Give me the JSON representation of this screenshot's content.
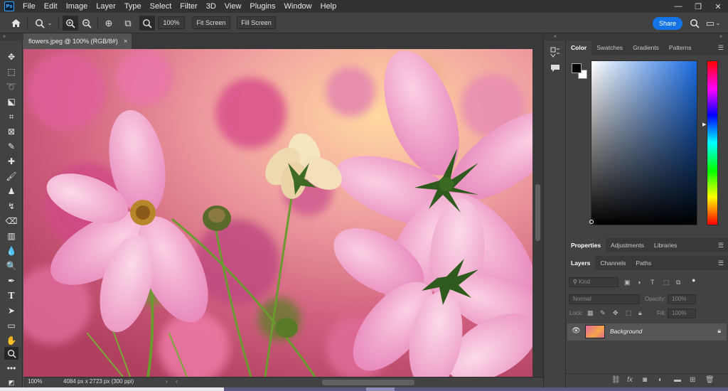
{
  "menu": {
    "logo": "Ps",
    "items": [
      "File",
      "Edit",
      "Image",
      "Layer",
      "Type",
      "Select",
      "Filter",
      "3D",
      "View",
      "Plugins",
      "Window",
      "Help"
    ],
    "window_controls": [
      "—",
      "❐",
      "✕"
    ]
  },
  "options": {
    "home_icon": "home-icon",
    "zoom_value": "100%",
    "fit_screen_label": "Fit Screen",
    "fill_screen_label": "Fill Screen",
    "share_label": "Share"
  },
  "document": {
    "tab_title": "flowers.jpeg @ 100% (RGB/8#)",
    "close": "×",
    "status_zoom": "100%",
    "status_dimensions": "4084 px x 2723 px (300 ppi)"
  },
  "color_panel": {
    "tabs": [
      "Color",
      "Swatches",
      "Gradients",
      "Patterns"
    ],
    "active_tab": "Color",
    "fg_color": "#000000",
    "bg_color": "#ffffff",
    "field_hue": "#1a6be0"
  },
  "properties_panel": {
    "tabs": [
      "Properties",
      "Adjustments",
      "Libraries"
    ],
    "active_tab": "Properties"
  },
  "layers_panel": {
    "tabs": [
      "Layers",
      "Channels",
      "Paths"
    ],
    "active_tab": "Layers",
    "kind_placeholder": "Kind",
    "blend_mode": "Normal",
    "opacity_label": "Opacity:",
    "opacity_value": "100%",
    "lock_label": "Lock:",
    "fill_label": "Fill:",
    "fill_value": "100%",
    "layers": [
      {
        "name": "Background",
        "visible": true,
        "locked": true
      }
    ]
  }
}
